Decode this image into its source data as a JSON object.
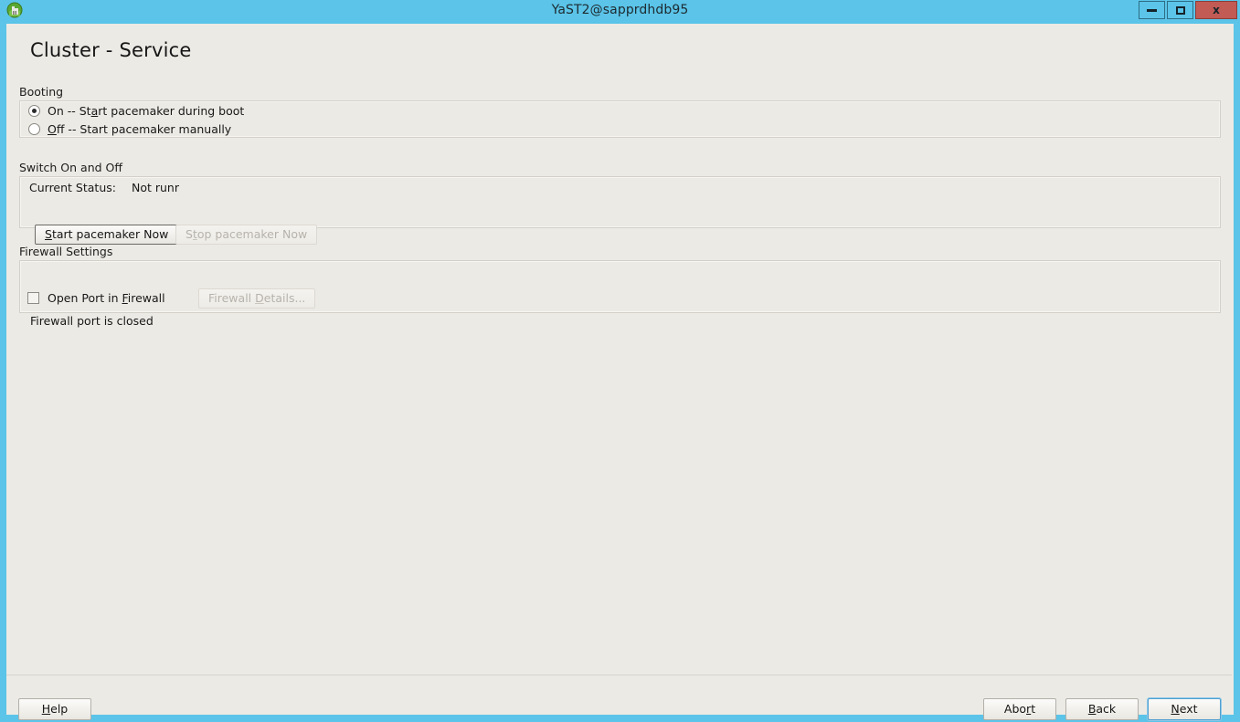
{
  "window": {
    "title": "YaST2@sapprdhdb95",
    "icon": "yast-globe-icon",
    "minimize_label": "Minimize",
    "maximize_label": "Maximize",
    "close_label": "Close",
    "close_glyph": "x",
    "accent_color": "#5bc4e8",
    "close_color": "#c15b54",
    "content_bg": "#eceae5"
  },
  "dialog": {
    "heading": "Cluster - Service"
  },
  "booting": {
    "group_label": "Booting",
    "options": [
      {
        "id": "on",
        "selected": true,
        "pre": "On -- St",
        "mnemonic": "a",
        "post": "rt pacemaker during boot"
      },
      {
        "id": "off",
        "selected": false,
        "pre": "",
        "mnemonic": "O",
        "post": "ff -- Start pacemaker manually"
      }
    ]
  },
  "switch_on_off": {
    "group_label": "Switch On and Off",
    "status_label": "Current Status:",
    "status_value": "Not runr",
    "start_button": {
      "pre": "",
      "mnemonic": "S",
      "post": "tart pacemaker Now",
      "enabled": true
    },
    "stop_button": {
      "pre": "S",
      "mnemonic": "t",
      "post": "op pacemaker Now",
      "enabled": false
    }
  },
  "firewall": {
    "group_label": "Firewall Settings",
    "open_port": {
      "checked": false,
      "pre": "Open Port in ",
      "mnemonic": "F",
      "post": "irewall"
    },
    "details_button": {
      "pre": "Firewall ",
      "mnemonic": "D",
      "post": "etails...",
      "enabled": false
    },
    "status_text": "Firewall port is closed"
  },
  "footer": {
    "help": {
      "pre": "",
      "mnemonic": "H",
      "post": "elp"
    },
    "abort": {
      "pre": "Abo",
      "mnemonic": "r",
      "post": "t"
    },
    "back": {
      "pre": "",
      "mnemonic": "B",
      "post": "ack"
    },
    "next": {
      "pre": "",
      "mnemonic": "N",
      "post": "ext",
      "focused": true
    }
  }
}
